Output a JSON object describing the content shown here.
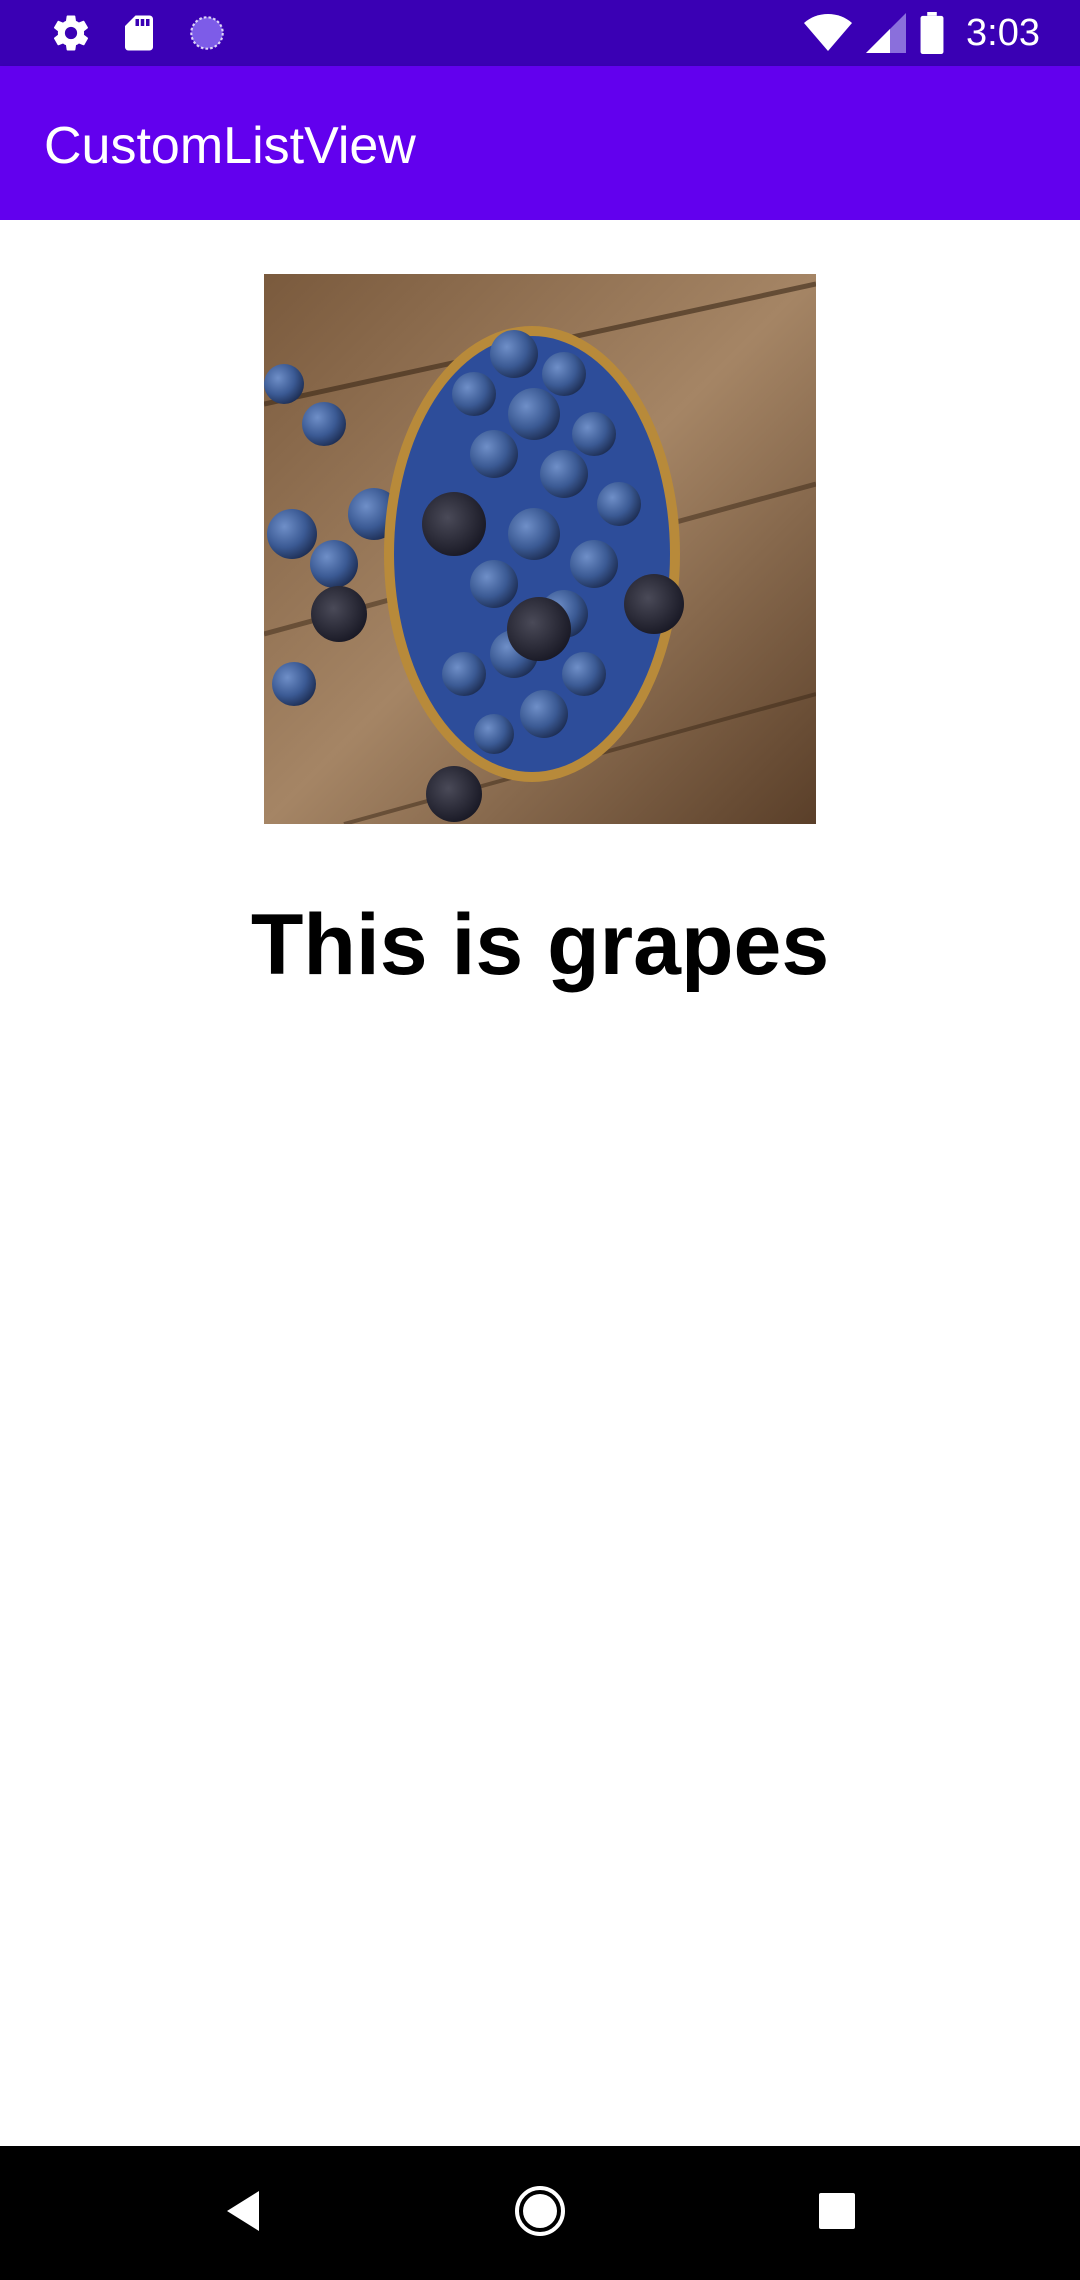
{
  "status_bar": {
    "time": "3:03",
    "left_icons": [
      "settings-icon",
      "sd-card-icon",
      "loading-icon"
    ],
    "right_icons": [
      "wifi-icon",
      "cell-signal-icon",
      "battery-icon"
    ],
    "background": "#3a00b4"
  },
  "app_bar": {
    "title": "CustomListView",
    "background": "#6200ee"
  },
  "content": {
    "image": "blueberries-bowl-photo",
    "caption": "This is grapes"
  },
  "nav_bar": {
    "buttons": [
      "back-icon",
      "home-icon",
      "recents-icon"
    ]
  }
}
